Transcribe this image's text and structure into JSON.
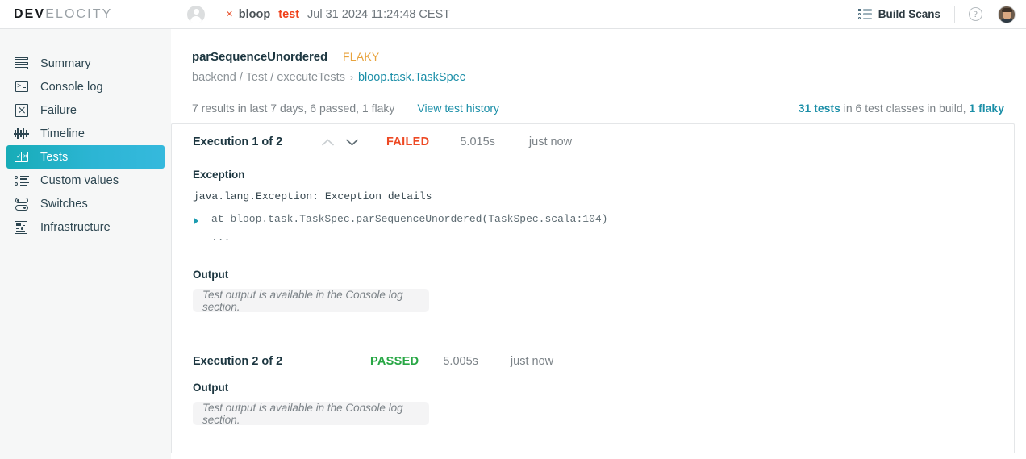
{
  "header": {
    "logo_bold": "DEV",
    "logo_light": "ELOCITY",
    "avatar_icon": "user-circle-icon",
    "fail_marker": "×",
    "project": "bloop",
    "task": "test",
    "timestamp": "Jul 31 2024 11:24:48 CEST",
    "build_scans_label": "Build Scans",
    "build_scans_icon": "list-icon",
    "help_label": "?",
    "help_icon": "question-circle-icon",
    "user_avatar_icon": "user-photo-avatar"
  },
  "sidebar": {
    "items": [
      {
        "label": "Summary",
        "icon": "summary-icon",
        "active": false
      },
      {
        "label": "Console log",
        "icon": "console-icon",
        "active": false
      },
      {
        "label": "Failure",
        "icon": "failure-x-icon",
        "active": false
      },
      {
        "label": "Timeline",
        "icon": "timeline-icon",
        "active": false
      },
      {
        "label": "Tests",
        "icon": "tests-icon",
        "active": true
      },
      {
        "label": "Custom values",
        "icon": "custom-values-icon",
        "active": false
      },
      {
        "label": "Switches",
        "icon": "switches-icon",
        "active": false
      },
      {
        "label": "Infrastructure",
        "icon": "infrastructure-icon",
        "active": false
      }
    ]
  },
  "test": {
    "name": "parSequenceUnordered",
    "flaky_badge": "FLAKY",
    "breadcrumb_path": "backend / Test / executeTests",
    "breadcrumb_separator": "›",
    "breadcrumb_class": "bloop.task.TaskSpec",
    "results_summary": "7 results in last 7 days, 6 passed, 1 flaky",
    "view_history_label": "View test history",
    "build_stats": {
      "tests_link": "31 tests",
      "middle": " in 6 test classes in build, ",
      "flaky_link": "1 flaky"
    }
  },
  "executions": [
    {
      "title": "Execution 1 of 2",
      "has_chevrons": true,
      "chevron_up_icon": "chevron-up-icon",
      "chevron_down_icon": "chevron-down-icon",
      "status": "FAILED",
      "status_kind": "failed",
      "duration": "5.015s",
      "time_ago": "just now",
      "exception_label": "Exception",
      "exception_message": "java.lang.Exception: Exception details",
      "stack_expand_icon": "expand-triangle-icon",
      "stack_line": "at bloop.task.TaskSpec.parSequenceUnordered(TaskSpec.scala:104)",
      "stack_ellipsis": "...",
      "output_label": "Output",
      "output_text": "Test output is available in the Console log section."
    },
    {
      "title": "Execution 2 of 2",
      "has_chevrons": false,
      "status": "PASSED",
      "status_kind": "passed",
      "duration": "5.005s",
      "time_ago": "just now",
      "output_label": "Output",
      "output_text": "Test output is available in the Console log section."
    }
  ],
  "colors": {
    "accent_teal": "#1c8fa8",
    "active_nav_start": "#17acb7",
    "active_nav_end": "#35b9dd",
    "status_failed": "#ed4924",
    "status_passed": "#28a745",
    "flaky_amber": "#e8a33d",
    "task_red": "#f0401a",
    "sidebar_bg": "#f6f7f7",
    "output_bg": "#f4f4f5"
  }
}
